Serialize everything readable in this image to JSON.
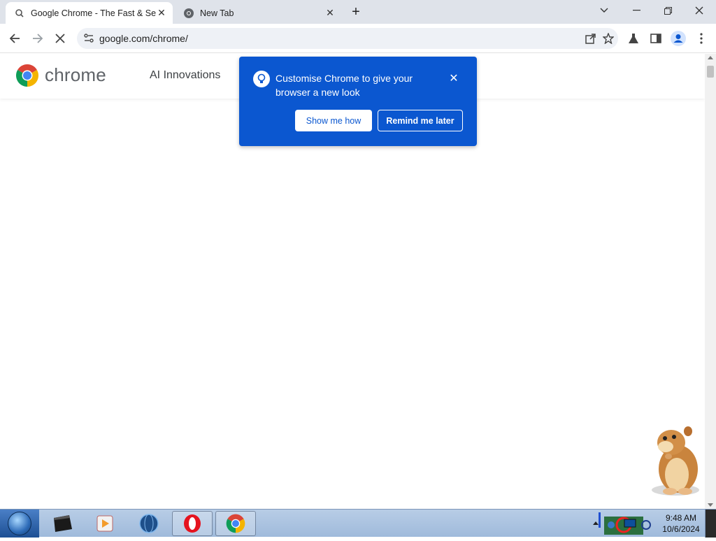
{
  "tabs": [
    {
      "title": "Google Chrome - The Fast & Se",
      "favicon": "loading-icon",
      "active": true
    },
    {
      "title": "New Tab",
      "favicon": "chrome-icon",
      "active": false
    }
  ],
  "window_controls": {
    "menu": "chevron-down-icon",
    "minimize": "minimize-icon",
    "restore": "restore-icon",
    "close": "close-icon"
  },
  "toolbar": {
    "url": "google.com/chrome/"
  },
  "page": {
    "logo_text": "chrome",
    "nav_link": "AI Innovations"
  },
  "bubble": {
    "message": "Customise Chrome to give your browser a new look",
    "primary_button": "Show me how",
    "secondary_button": "Remind me later",
    "color": "#0b57d0"
  },
  "taskbar": {
    "time": "9:48 AM",
    "date": "10/6/2024"
  }
}
